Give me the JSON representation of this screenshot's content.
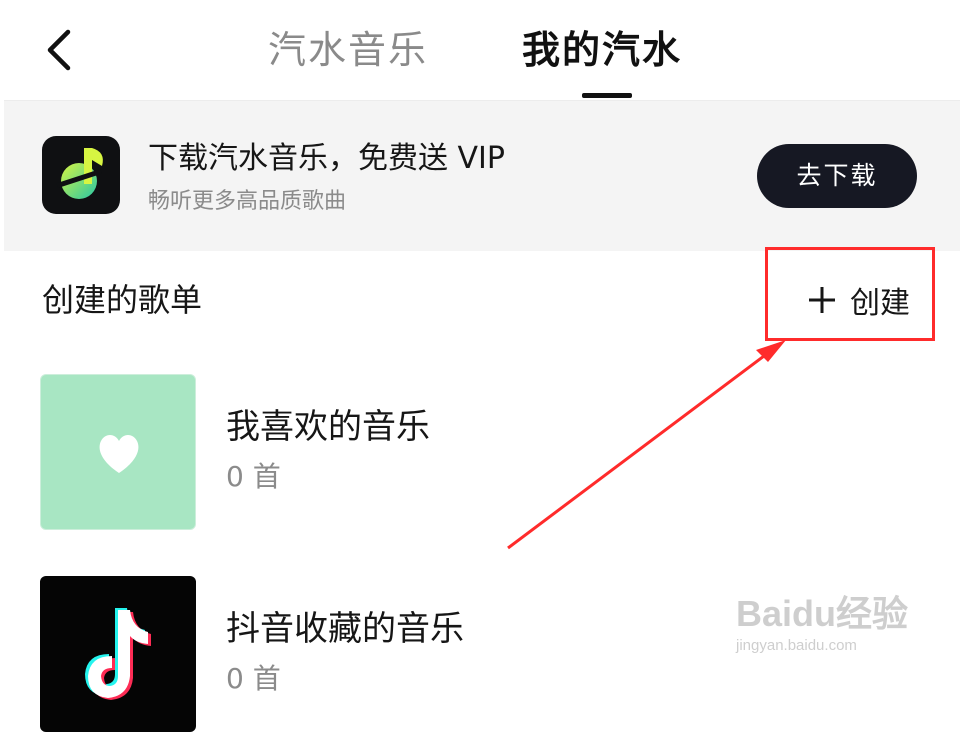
{
  "header": {
    "tabs": [
      {
        "label": "汽水音乐",
        "active": false
      },
      {
        "label": "我的汽水",
        "active": true
      }
    ]
  },
  "banner": {
    "title": "下载汽水音乐，免费送 VIP",
    "subtitle": "畅听更多高品质歌曲",
    "button_label": "去下载",
    "logo_icon": "soda-music-logo-icon"
  },
  "section": {
    "title": "创建的歌单",
    "create_label": "创建",
    "create_icon": "plus-icon"
  },
  "playlists": [
    {
      "name": "我喜欢的音乐",
      "count": "0 首",
      "cover_icon": "heart-icon",
      "cover_color": "#a8e6c3"
    },
    {
      "name": "抖音收藏的音乐",
      "count": "0 首",
      "cover_icon": "douyin-logo-icon",
      "cover_color": "#050505"
    }
  ],
  "annotation": {
    "color": "#ff2b2b"
  },
  "watermark": {
    "brand": "Baidu经验",
    "url": "jingyan.baidu.com"
  }
}
